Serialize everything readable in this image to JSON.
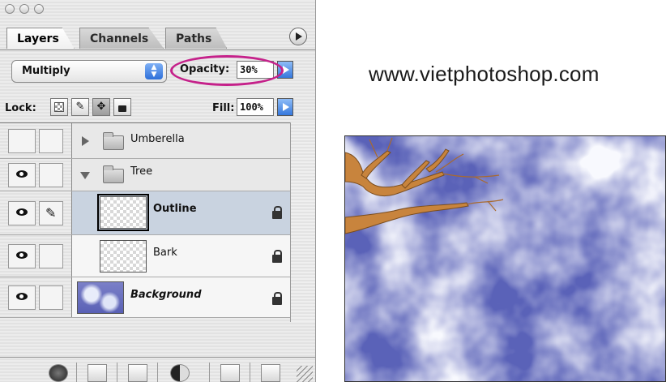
{
  "palette": {
    "tabs": [
      {
        "label": "Layers",
        "active": true
      },
      {
        "label": "Channels",
        "active": false
      },
      {
        "label": "Paths",
        "active": false
      }
    ],
    "blend_mode": "Multiply",
    "opacity": {
      "label": "Opacity:",
      "value": "30%"
    },
    "lock": {
      "label": "Lock:"
    },
    "fill": {
      "label": "Fill:",
      "value": "100%"
    },
    "layers": [
      {
        "name": "Umberella",
        "type": "group",
        "expanded": false,
        "visible": false
      },
      {
        "name": "Tree",
        "type": "group",
        "expanded": true,
        "visible": true
      },
      {
        "name": "Outline",
        "type": "layer",
        "selected": true,
        "visible": true,
        "locked": true
      },
      {
        "name": "Bark",
        "type": "layer",
        "selected": false,
        "visible": true,
        "locked": true
      },
      {
        "name": "Background",
        "type": "layer",
        "selected": false,
        "visible": true,
        "locked": true
      }
    ],
    "highlight_color": "#c5218a"
  },
  "website": "www.vietphotoshop.com",
  "image": {
    "sky_color": "#5a62b8",
    "branch_color": "#c8843d"
  }
}
